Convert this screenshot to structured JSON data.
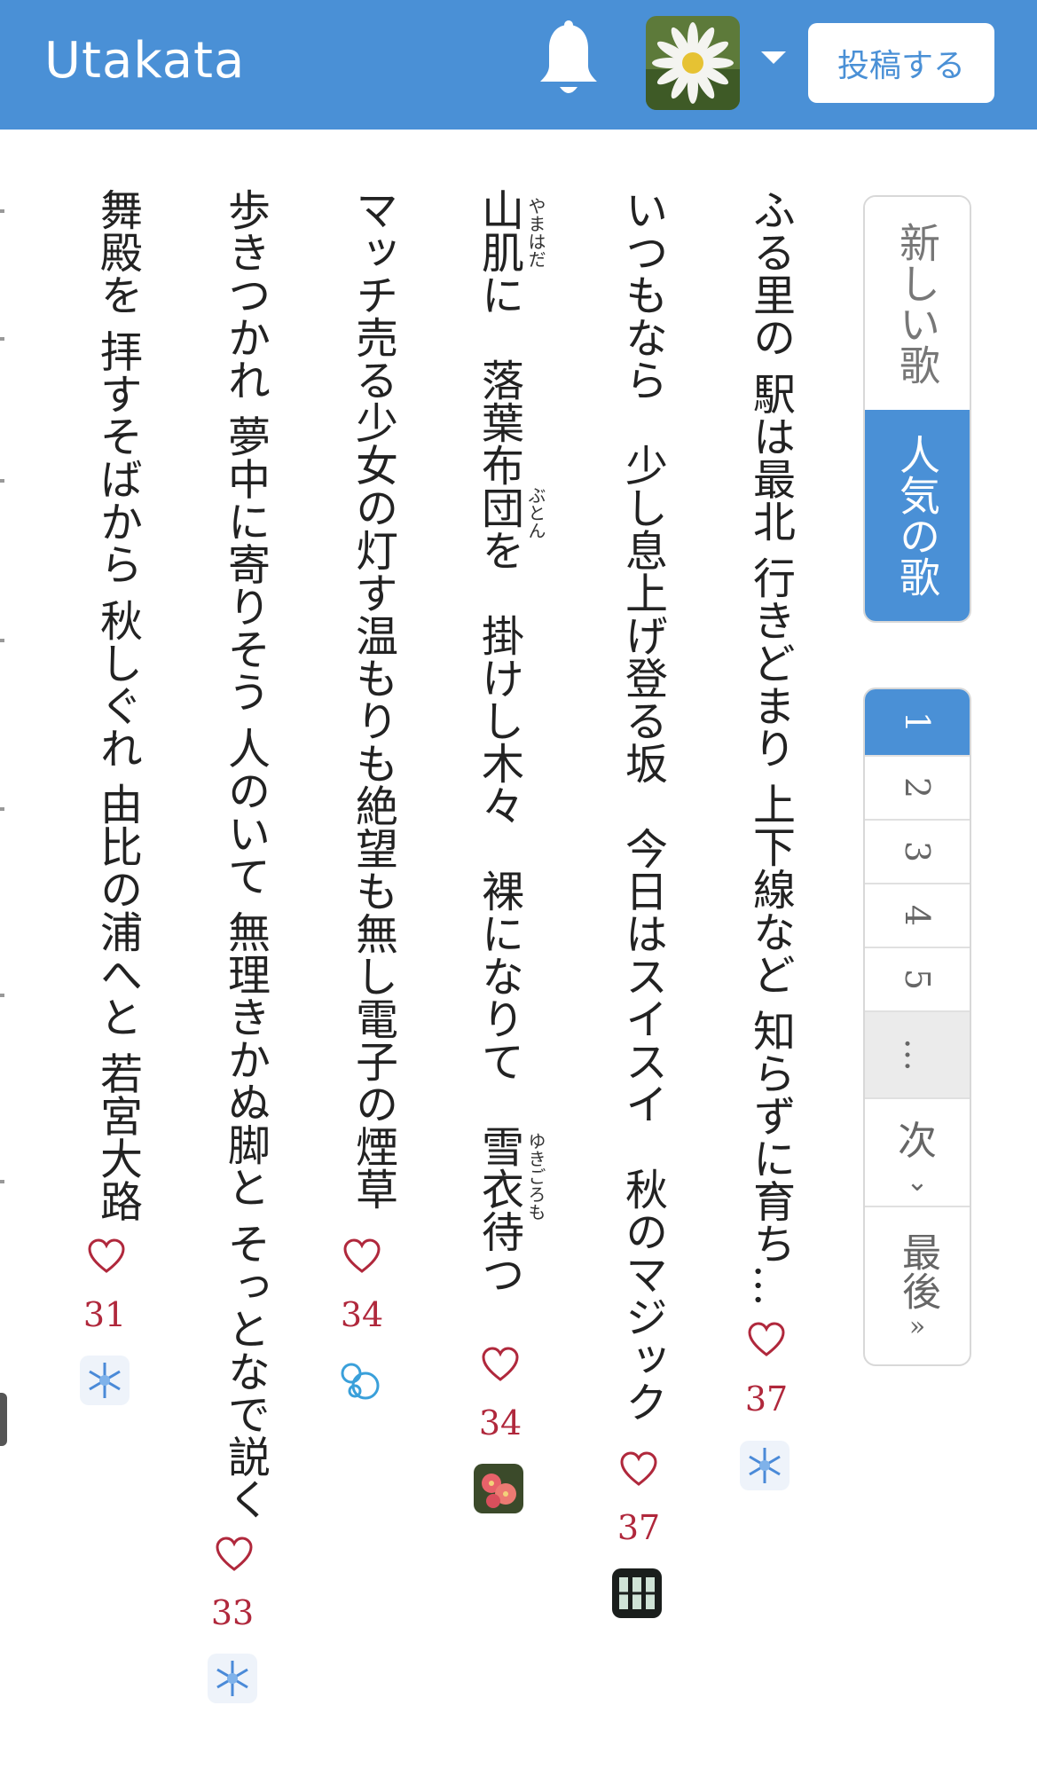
{
  "header": {
    "brand": "Utakata",
    "post_label": "投稿する",
    "icons": {
      "bell": "bell-icon",
      "menu": "chevron-down-icon"
    }
  },
  "tabs": [
    {
      "label": "新しい歌",
      "active": false
    },
    {
      "label": "人気の歌",
      "active": true
    }
  ],
  "pagination": {
    "pages": [
      "1",
      "2",
      "3",
      "4",
      "5"
    ],
    "ellipsis": "…",
    "next_label": "次",
    "last_label": "最後"
  },
  "poems": [
    {
      "text": "ふる里の 駅は最北 行きどまり 上下線など 知らずに育ち…",
      "likes": "37",
      "ruby": []
    },
    {
      "text": "いつもなら　少し息上げ登る坂　今日はスイスイ　秋のマジック",
      "likes": "37",
      "ruby": []
    },
    {
      "text": "山肌に　落葉布団を　掛けし木々　裸になりて　雪衣待つ",
      "likes": "34",
      "ruby": [
        "やまはだ",
        "ぶとん",
        "ゆきごろも"
      ]
    },
    {
      "text": "マッチ売る少女の灯す温もりも絶望も無し電子の煙草",
      "likes": "34",
      "ruby": []
    },
    {
      "text": "歩きつかれ 夢中に寄りそう 人のいて 無理きかぬ脚と そっとなで説く",
      "likes": "33",
      "ruby": []
    },
    {
      "text": "舞殿を 拝すそばから 秋しぐれ 由比の浦へと 若宮大路",
      "likes": "31",
      "ruby": []
    }
  ],
  "colors": {
    "header": "#4a90d6",
    "accent": "#4a90d6",
    "likes": "#b0283c"
  }
}
